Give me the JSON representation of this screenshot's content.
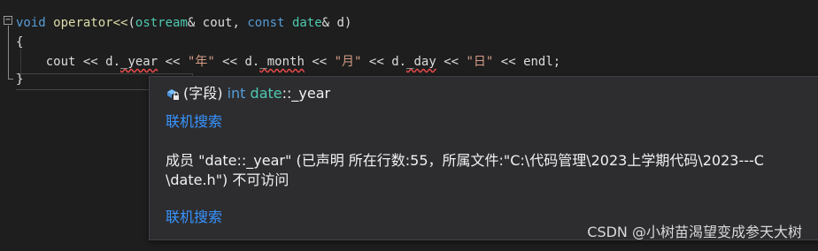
{
  "code": {
    "line1": {
      "kw_void": "void",
      "fn_name": "operator<<",
      "open_paren": "(",
      "type_ostream": "ostream",
      "param1": "& cout, ",
      "kw_const": "const",
      "space": " ",
      "type_date": "date",
      "param2": "& d)"
    },
    "line2": "{",
    "line3": {
      "indent": "    ",
      "t1": "cout << d.",
      "field_year": "_year",
      "t2": " << ",
      "s_year": "\"年\"",
      "t3": " << d.",
      "field_month": "_month",
      "t4": " << ",
      "s_month": "\"月\"",
      "t5": " << d.",
      "field_day": "_day",
      "t6": " << ",
      "s_day": "\"日\"",
      "t7": " << endl;"
    },
    "line4": "}"
  },
  "tooltip": {
    "kind": "(字段)",
    "type_kw": "int",
    "scope_type": "date",
    "member": "::_year",
    "search_link_1": "联机搜索",
    "description_line1": "成员 \"date::_year\" (已声明 所在行数:55，所属文件:\"C:\\代码管理\\2023上学期代码\\2023---C",
    "description_line2": "\\date.h\") 不可访问",
    "search_link_2": "联机搜索",
    "icon": "field-lock-icon"
  },
  "watermark": "CSDN @小树苗渴望变成参天大树",
  "colors": {
    "background": "#1e1e1e",
    "keyword": "#569cd6",
    "function": "#dcdcaa",
    "type": "#4ec9b0",
    "string": "#d69d85",
    "error_squiggle": "#f14c4c",
    "link": "#3794ff",
    "tooltip_bg": "#2d2d30"
  }
}
